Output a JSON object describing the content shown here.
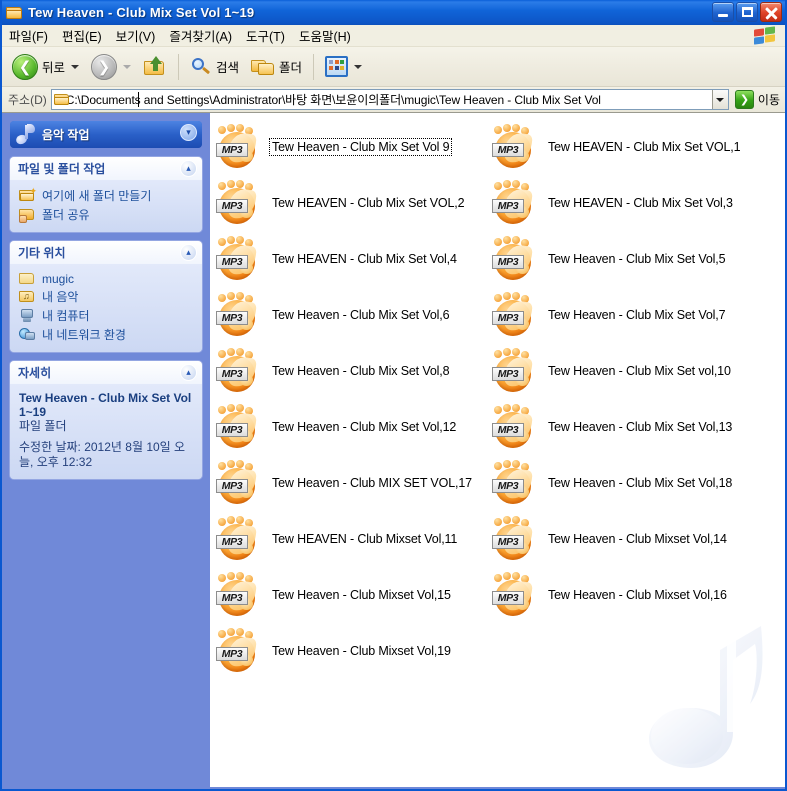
{
  "window": {
    "title": "Tew Heaven  - Club Mix Set Vol 1~19",
    "controls": {
      "minimize": "_",
      "maximize": "□",
      "close": "✕"
    }
  },
  "menubar": [
    {
      "label": "파일(F)",
      "key": "F"
    },
    {
      "label": "편집(E)",
      "key": "E"
    },
    {
      "label": "보기(V)",
      "key": "V"
    },
    {
      "label": "즐겨찾기(A)",
      "key": "A"
    },
    {
      "label": "도구(T)",
      "key": "T"
    },
    {
      "label": "도움말(H)",
      "key": "H"
    }
  ],
  "toolbar": {
    "back": "뒤로",
    "forward": "",
    "up": "",
    "search": "검색",
    "folders": "폴더",
    "views": ""
  },
  "address": {
    "label": "주소(D)",
    "value": "C:\\Documents and Settings\\Administrator\\바탕 화면\\보윤이의폴더\\mugic\\Tew Heaven  - Club Mix Set Vol",
    "go_label": "이동"
  },
  "sidebar": {
    "music_task": {
      "title": "음악 작업"
    },
    "file_folder_task": {
      "title": "파일 및 폴더 작업",
      "items": [
        {
          "label": "여기에 새 폴더 만들기",
          "icon": "new-folder-icon"
        },
        {
          "label": "폴더 공유",
          "icon": "share-folder-icon"
        }
      ]
    },
    "other_places": {
      "title": "기타 위치",
      "items": [
        {
          "label": "mugic",
          "icon": "folder-icon"
        },
        {
          "label": "내 음악",
          "icon": "my-music-icon"
        },
        {
          "label": "내 컴퓨터",
          "icon": "my-computer-icon"
        },
        {
          "label": "내 네트워크 환경",
          "icon": "my-network-icon"
        }
      ]
    },
    "details": {
      "title": "자세히",
      "name": "Tew Heaven  - Club Mix Set Vol 1~19",
      "type": "파일 폴더",
      "modified": "수정한 날짜: 2012년 8월 10일 오늘, 오후 12:32"
    }
  },
  "files": [
    {
      "name": "Tew Heaven  - Club Mix Set Vol 9",
      "focused": true
    },
    {
      "name": "Tew HEAVEN - Club Mix Set VOL,1",
      "focused": false
    },
    {
      "name": "Tew HEAVEN - Club Mix Set VOL,2",
      "focused": false
    },
    {
      "name": "Tew HEAVEN - Club Mix Set Vol,3",
      "focused": false
    },
    {
      "name": "Tew HEAVEN - Club Mix Set Vol,4",
      "focused": false
    },
    {
      "name": "Tew Heaven - Club Mix Set Vol,5",
      "focused": false
    },
    {
      "name": "Tew Heaven - Club Mix Set Vol,6",
      "focused": false
    },
    {
      "name": "Tew Heaven - Club Mix Set Vol,7",
      "focused": false
    },
    {
      "name": "Tew Heaven - Club Mix Set Vol,8",
      "focused": false
    },
    {
      "name": "Tew Heaven - Club Mix Set vol,10",
      "focused": false
    },
    {
      "name": "Tew Heaven - Club Mix Set Vol,12",
      "focused": false
    },
    {
      "name": "Tew Heaven - Club Mix Set Vol,13",
      "focused": false
    },
    {
      "name": "Tew Heaven - Club MIX SET VOL,17",
      "focused": false
    },
    {
      "name": "Tew Heaven - Club Mix Set Vol,18",
      "focused": false
    },
    {
      "name": "Tew HEAVEN - Club Mixset Vol,11",
      "focused": false
    },
    {
      "name": "Tew Heaven - Club Mixset Vol,14",
      "focused": false
    },
    {
      "name": "Tew Heaven - Club Mixset Vol,15",
      "focused": false
    },
    {
      "name": "Tew Heaven - Club Mixset Vol,16",
      "focused": false
    },
    {
      "name": "Tew Heaven - Club Mixset Vol,19",
      "focused": false
    }
  ],
  "file_icon_badge": "MP3",
  "colors": {
    "titlebar_blue": "#1064d8",
    "sidebar_blue": "#7089d8",
    "panel_light": "#d6dff7",
    "panel_header_text": "#2a4f9e",
    "link_text": "#1d4f9b",
    "toolbar_bg": "#efece0",
    "go_green": "#35a216",
    "mp3_orange": "#f07f12"
  }
}
